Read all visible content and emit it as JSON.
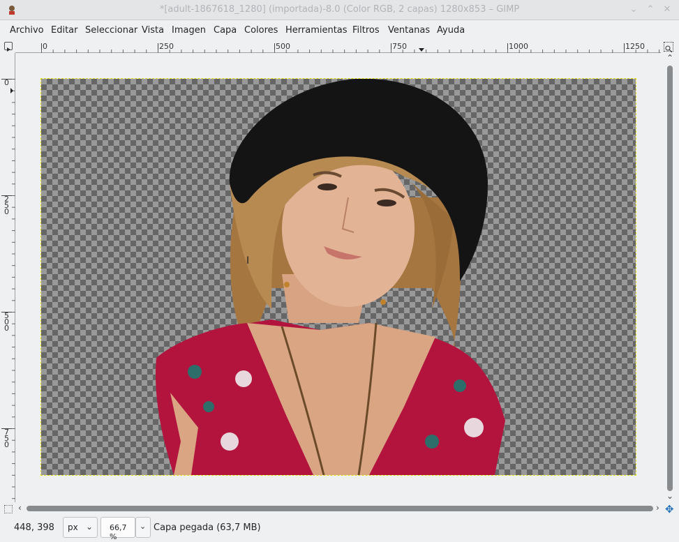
{
  "window": {
    "title": "*[adult-1867618_1280] (importada)-8.0 (Color RGB, 2 capas) 1280x853 – GIMP",
    "icons": [
      "gimp-wilber-icon",
      "chevron-down-icon",
      "chevron-up-icon",
      "close-icon"
    ]
  },
  "menubar": {
    "items": [
      "Archivo",
      "Editar",
      "Seleccionar",
      "Vista",
      "Imagen",
      "Capa",
      "Colores",
      "Herramientas",
      "Filtros",
      "Ventanas",
      "Ayuda"
    ]
  },
  "rulers": {
    "horizontal_labels": [
      "0",
      "250",
      "500",
      "750",
      "1000",
      "1250"
    ],
    "vertical_labels": [
      "0",
      "250",
      "500",
      "750"
    ]
  },
  "canvas": {
    "layer_background": "transparent-checkerboard",
    "selection_color": "#e5e500"
  },
  "statusbar": {
    "coords": "448, 398",
    "unit": "px",
    "zoom": "66,7 %",
    "message": "Capa pegada (63,7 MB)"
  },
  "colors": {
    "dress": "#b3143e",
    "hat": "#141414",
    "skin": "#e2b395",
    "hair": "#b78a52",
    "scroll_accent": "#1d6fb8"
  }
}
